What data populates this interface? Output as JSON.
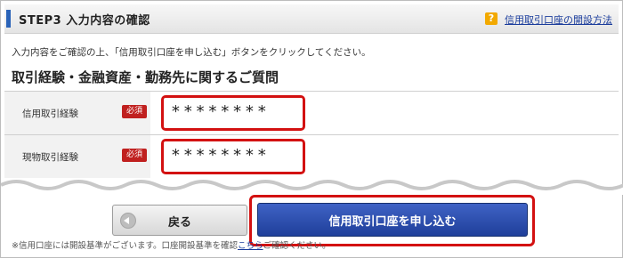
{
  "header": {
    "step_title": "STEP3 入力内容の確認",
    "help_icon": "?",
    "help_link": "信用取引口座の開設方法"
  },
  "intro_text": "入力内容をご確認の上、「信用取引口座を申し込む」ボタンをクリックしてください。",
  "section": {
    "title": "取引経験・金融資産・勤務先に関するご質問",
    "rows": [
      {
        "label": "信用取引経験",
        "badge": "必須",
        "value": "********"
      },
      {
        "label": "現物取引経験",
        "badge": "必須",
        "value": "********"
      }
    ]
  },
  "buttons": {
    "back_label": "戻る",
    "submit_label": "信用取引口座を申し込む"
  },
  "footer": {
    "note_prefix": "※信用口座には開設基準がございます。口座開設基準を確認",
    "note_link": "こちら",
    "note_suffix": "ご確認ください。"
  },
  "colors": {
    "accent_blue": "#2a63b8",
    "highlight_red": "#d31111",
    "badge_red": "#c0201f"
  }
}
